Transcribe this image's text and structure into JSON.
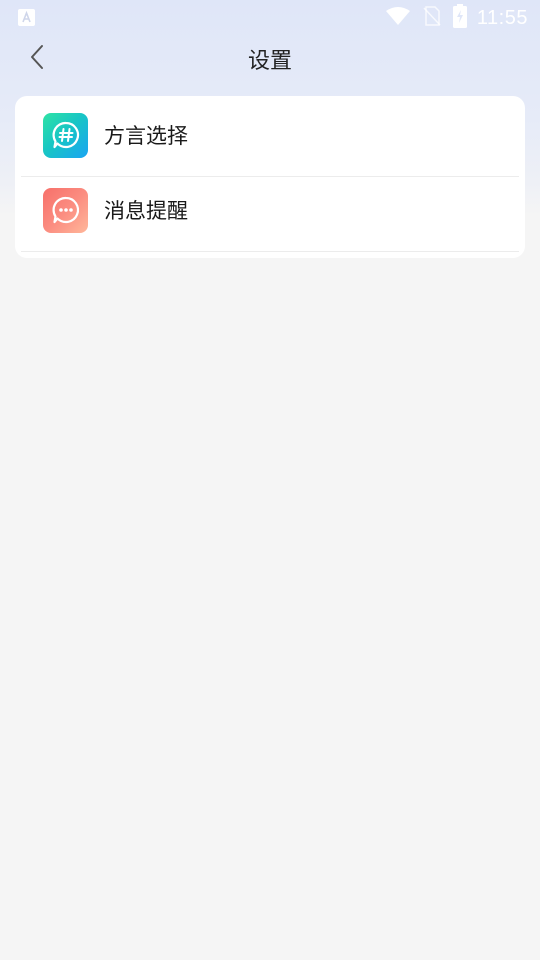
{
  "status_bar": {
    "time": "11:55",
    "icons": [
      "notification-a-icon",
      "wifi-icon",
      "no-sim-icon",
      "battery-charging-icon"
    ]
  },
  "nav": {
    "title": "设置",
    "back_icon": "chevron-left-icon"
  },
  "settings": {
    "items": [
      {
        "label": "方言选择",
        "icon": "hashtag-chat-icon",
        "icon_colors": [
          "#2fe3a4",
          "#1aa4f2"
        ]
      },
      {
        "label": "消息提醒",
        "icon": "message-dots-icon",
        "icon_colors": [
          "#f7706a",
          "#ffb79a"
        ]
      }
    ]
  },
  "colors": {
    "header_gradient_top": "#dfe6f8",
    "page_background": "#f5f5f5",
    "card_background": "#ffffff"
  }
}
